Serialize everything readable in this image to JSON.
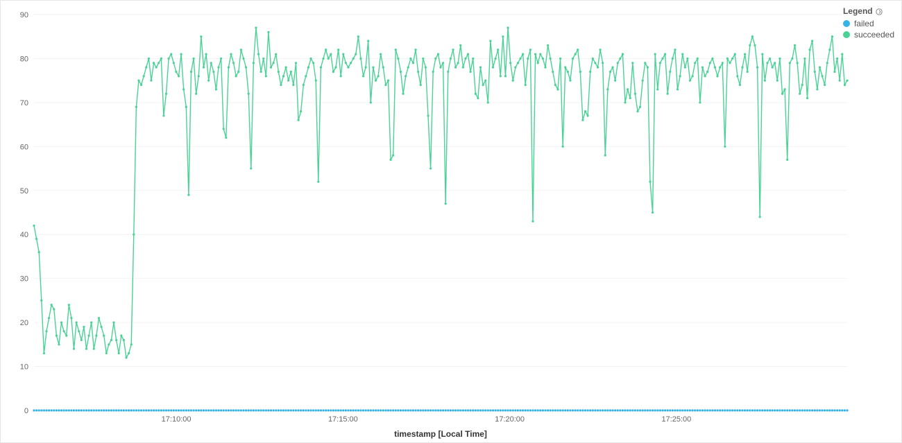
{
  "legend": {
    "title": "Legend",
    "items": [
      {
        "label": "failed",
        "color": "#36b3e6"
      },
      {
        "label": "succeeded",
        "color": "#4ad295"
      }
    ]
  },
  "axes": {
    "xlabel": "timestamp [Local Time]",
    "x_ticks": [
      "17:10:00",
      "17:15:00",
      "17:20:00",
      "17:25:00"
    ],
    "y_ticks": [
      "0",
      "10",
      "20",
      "30",
      "40",
      "50",
      "60",
      "70",
      "80",
      "90"
    ]
  },
  "chart_data": {
    "type": "line",
    "xlabel": "timestamp [Local Time]",
    "ylabel": "",
    "ylim": [
      0,
      90
    ],
    "x_tick_labels": [
      "17:10:00",
      "17:15:00",
      "17:20:00",
      "17:25:00"
    ],
    "series": [
      {
        "name": "succeeded",
        "color": "#4ad295",
        "values": [
          42,
          39,
          36,
          25,
          13,
          18,
          21,
          24,
          23,
          17,
          15,
          20,
          18,
          17,
          24,
          21,
          14,
          20,
          18,
          16,
          19,
          14,
          17,
          20,
          14,
          17,
          21,
          19,
          17,
          13,
          15,
          16,
          20,
          16,
          13,
          17,
          16,
          12,
          13,
          15,
          40,
          69,
          75,
          74,
          76,
          78,
          80,
          75,
          79,
          78,
          79,
          80,
          67,
          72,
          80,
          81,
          79,
          77,
          76,
          81,
          73,
          69,
          49,
          77,
          80,
          72,
          76,
          85,
          78,
          81,
          75,
          79,
          77,
          73,
          78,
          80,
          64,
          62,
          78,
          81,
          79,
          76,
          77,
          82,
          80,
          78,
          72,
          55,
          79,
          87,
          81,
          77,
          80,
          76,
          86,
          78,
          79,
          81,
          77,
          74,
          76,
          78,
          75,
          77,
          74,
          79,
          66,
          68,
          74,
          76,
          78,
          80,
          79,
          75,
          52,
          78,
          80,
          82,
          80,
          81,
          77,
          78,
          82,
          76,
          81,
          79,
          78,
          79,
          80,
          81,
          85,
          80,
          76,
          78,
          84,
          70,
          78,
          75,
          76,
          81,
          78,
          74,
          75,
          57,
          58,
          82,
          80,
          77,
          72,
          76,
          78,
          80,
          79,
          82,
          77,
          74,
          80,
          78,
          67,
          55,
          77,
          80,
          81,
          78,
          79,
          47,
          77,
          80,
          82,
          78,
          79,
          83,
          78,
          80,
          81,
          77,
          80,
          72,
          71,
          78,
          74,
          75,
          70,
          84,
          78,
          80,
          82,
          76,
          85,
          76,
          87,
          79,
          75,
          78,
          79,
          80,
          81,
          74,
          80,
          82,
          43,
          81,
          79,
          81,
          80,
          78,
          83,
          80,
          77,
          74,
          73,
          80,
          60,
          78,
          77,
          75,
          80,
          81,
          82,
          77,
          66,
          68,
          67,
          77,
          80,
          79,
          78,
          82,
          79,
          58,
          73,
          77,
          78,
          75,
          79,
          80,
          81,
          70,
          73,
          71,
          79,
          72,
          68,
          69,
          75,
          79,
          78,
          52,
          45,
          81,
          73,
          79,
          80,
          81,
          72,
          77,
          80,
          82,
          73,
          76,
          81,
          78,
          80,
          75,
          76,
          79,
          80,
          70,
          78,
          76,
          77,
          79,
          80,
          78,
          76,
          78,
          79,
          60,
          80,
          79,
          80,
          81,
          76,
          74,
          78,
          81,
          77,
          83,
          85,
          83,
          78,
          44,
          81,
          75,
          79,
          80,
          78,
          79,
          75,
          80,
          72,
          73,
          57,
          79,
          80,
          83,
          79,
          72,
          74,
          80,
          71,
          82,
          84,
          77,
          73,
          78,
          76,
          74,
          79,
          82,
          85,
          77,
          80,
          75,
          81,
          74,
          75
        ]
      },
      {
        "name": "failed",
        "color": "#36b3e6",
        "constant_value": 0,
        "length": 314
      }
    ]
  }
}
